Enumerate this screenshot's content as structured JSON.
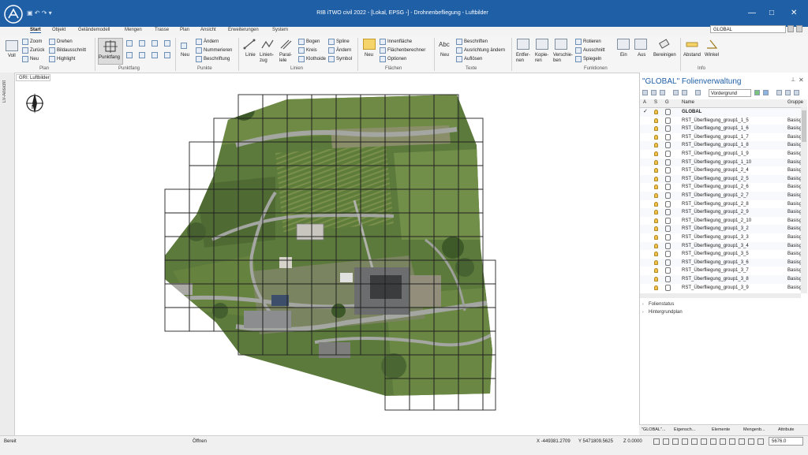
{
  "app": {
    "title": "RIB iTWO civil 2022 - [Lokal, EPSG -] - Drohnenbefliegung - Luftbilder",
    "quick_access": "▣ ↶ ↷ ▾"
  },
  "window_controls": {
    "minimize": "—",
    "maximize": "□",
    "close": "✕"
  },
  "tabs": [
    "Start",
    "Objekt",
    "Geländemodell",
    "Mengen",
    "Trasse",
    "Plan",
    "Ansicht",
    "Erweiterungen",
    "System"
  ],
  "global_select": "GLOBAL",
  "ribbon": {
    "plan": {
      "voll": "Voll",
      "zoom": "Zoom",
      "zurueck": "Zurück",
      "neu": "Neu",
      "drehen": "Drehen",
      "bildausschnitt": "Bildausschnitt",
      "highlight": "Highlight",
      "label": "Plan"
    },
    "punktfang": {
      "button": "Punktfang",
      "label": "Punktfang"
    },
    "punkte": {
      "neu": "Neu",
      "aendern": "Ändern",
      "nummerieren": "Nummerieren",
      "beschriftung": "Beschriftung",
      "label": "Punkte"
    },
    "linien": {
      "linie": "Linie",
      "linienzug": "Linien-zug",
      "parallele": "Paral-lele",
      "bogen": "Bogen",
      "kreis": "Kreis",
      "klothoide": "Klothoide",
      "spline": "Spline",
      "aendern": "Ändern",
      "symbol": "Symbol",
      "label": "Linien"
    },
    "flaechen": {
      "neu": "Neu",
      "innenflaeche": "Innenfläche",
      "flaechenberechner": "Flächenberechner",
      "optionen": "Optionen",
      "label": "Flächen"
    },
    "texte": {
      "abc": "Abc",
      "neu": "Neu",
      "beschriften": "Beschriften",
      "ausrichtung": "Ausrichtung ändern",
      "aufloesen": "Auflösen",
      "label": "Texte"
    },
    "funktionen": {
      "entfernen": "Entfer-nen",
      "kopieren": "Kopie-ren",
      "verschieben": "Verschie-ben",
      "rotieren": "Rotieren",
      "ausschneiden": "Ausschnitt",
      "spiegeln": "Spiegeln",
      "ein": "Ein",
      "aus": "Aus",
      "bereinigen": "Bereinigen",
      "label": "Funktionen"
    },
    "info": {
      "abstand": "Abstand",
      "winkel": "Winkel",
      "label": "Info"
    }
  },
  "left_strip": "LV-Ansicht",
  "doc_tab": "GRI: Luftbilder",
  "compass": "N",
  "panel": {
    "title": "\"GLOBAL\"  Folienverwaltung",
    "filter": "Vordergrund",
    "headers": {
      "a": "A",
      "s": "S",
      "g": "G",
      "name": "Name",
      "gruppe": "Gruppe"
    },
    "rows": [
      {
        "name": "GLOBAL",
        "group": ""
      },
      {
        "name": "RST_Überfliegung_group1_1_5",
        "group": "Basisg"
      },
      {
        "name": "RST_Überfliegung_group1_1_6",
        "group": "Basisg"
      },
      {
        "name": "RST_Überfliegung_group1_1_7",
        "group": "Basisg"
      },
      {
        "name": "RST_Überfliegung_group1_1_8",
        "group": "Basisg"
      },
      {
        "name": "RST_Überfliegung_group1_1_9",
        "group": "Basisg"
      },
      {
        "name": "RST_Überfliegung_group1_1_10",
        "group": "Basisg"
      },
      {
        "name": "RST_Überfliegung_group1_2_4",
        "group": "Basisg"
      },
      {
        "name": "RST_Überfliegung_group1_2_5",
        "group": "Basisg"
      },
      {
        "name": "RST_Überfliegung_group1_2_6",
        "group": "Basisg"
      },
      {
        "name": "RST_Überfliegung_group1_2_7",
        "group": "Basisg"
      },
      {
        "name": "RST_Überfliegung_group1_2_8",
        "group": "Basisg"
      },
      {
        "name": "RST_Überfliegung_group1_2_9",
        "group": "Basisg"
      },
      {
        "name": "RST_Überfliegung_group1_2_10",
        "group": "Basisg"
      },
      {
        "name": "RST_Überfliegung_group1_3_2",
        "group": "Basisg"
      },
      {
        "name": "RST_Überfliegung_group1_3_3",
        "group": "Basisg"
      },
      {
        "name": "RST_Überfliegung_group1_3_4",
        "group": "Basisg"
      },
      {
        "name": "RST_Überfliegung_group1_3_5",
        "group": "Basisg"
      },
      {
        "name": "RST_Überfliegung_group1_3_6",
        "group": "Basisg"
      },
      {
        "name": "RST_Überfliegung_group1_3_7",
        "group": "Basisg"
      },
      {
        "name": "RST_Überfliegung_group1_3_8",
        "group": "Basisg"
      },
      {
        "name": "RST_Überfliegung_group1_3_9",
        "group": "Basisg"
      }
    ],
    "sections": [
      "Folienstatus",
      "Hintergrundplan"
    ],
    "bottom_tabs": [
      "\"GLOBAL\"...",
      "Eigensch...",
      "Elemente",
      "Mengenb...",
      "Attribute"
    ]
  },
  "status": {
    "left": "Bereit",
    "mode": "Öffnen",
    "x": "X   -449381.2709",
    "y": "Y   5471809.5625",
    "z": "Z   0.0000",
    "scale": "5676.0"
  },
  "colors": {
    "brand": "#1f5fa6",
    "terrain_green": "#5c7a3c",
    "road": "#9a9c98"
  }
}
